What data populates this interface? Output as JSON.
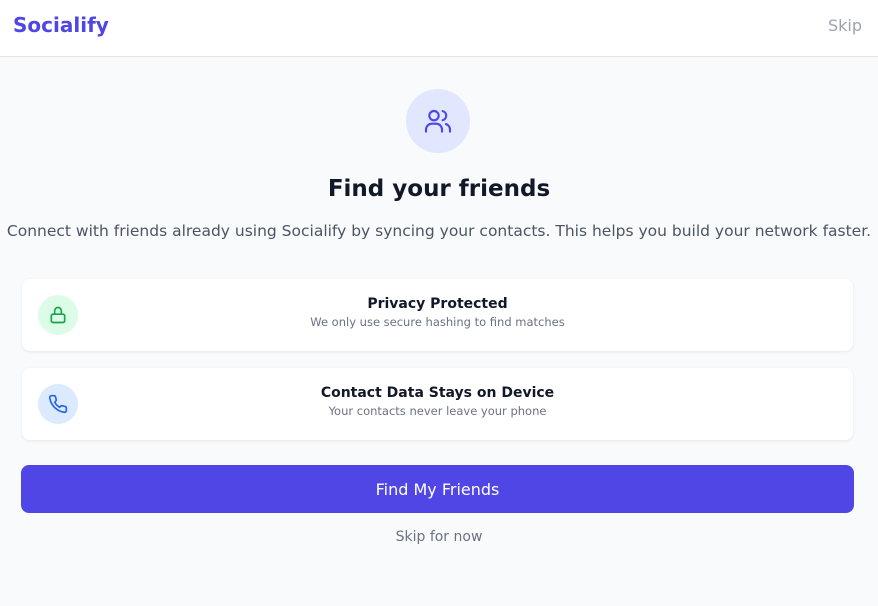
{
  "header": {
    "brand": "Socialify",
    "skip_label": "Skip"
  },
  "hero": {
    "icon": "users-icon",
    "title": "Find your friends",
    "subtitle": "Connect with friends already using Socialify by syncing your contacts. This helps you build your network faster."
  },
  "features": [
    {
      "icon": "lock-icon",
      "title": "Privacy Protected",
      "description": "We only use secure hashing to find matches"
    },
    {
      "icon": "phone-icon",
      "title": "Contact Data Stays on Device",
      "description": "Your contacts never leave your phone"
    }
  ],
  "actions": {
    "primary_label": "Find My Friends",
    "secondary_label": "Skip for now"
  },
  "colors": {
    "brand": "#4f46e5",
    "hero_icon_bg": "#e0e7ff",
    "lock_icon_bg": "#dcfce7",
    "lock_icon": "#16a34a",
    "phone_icon_bg": "#dbeafe",
    "phone_icon": "#2563eb"
  }
}
